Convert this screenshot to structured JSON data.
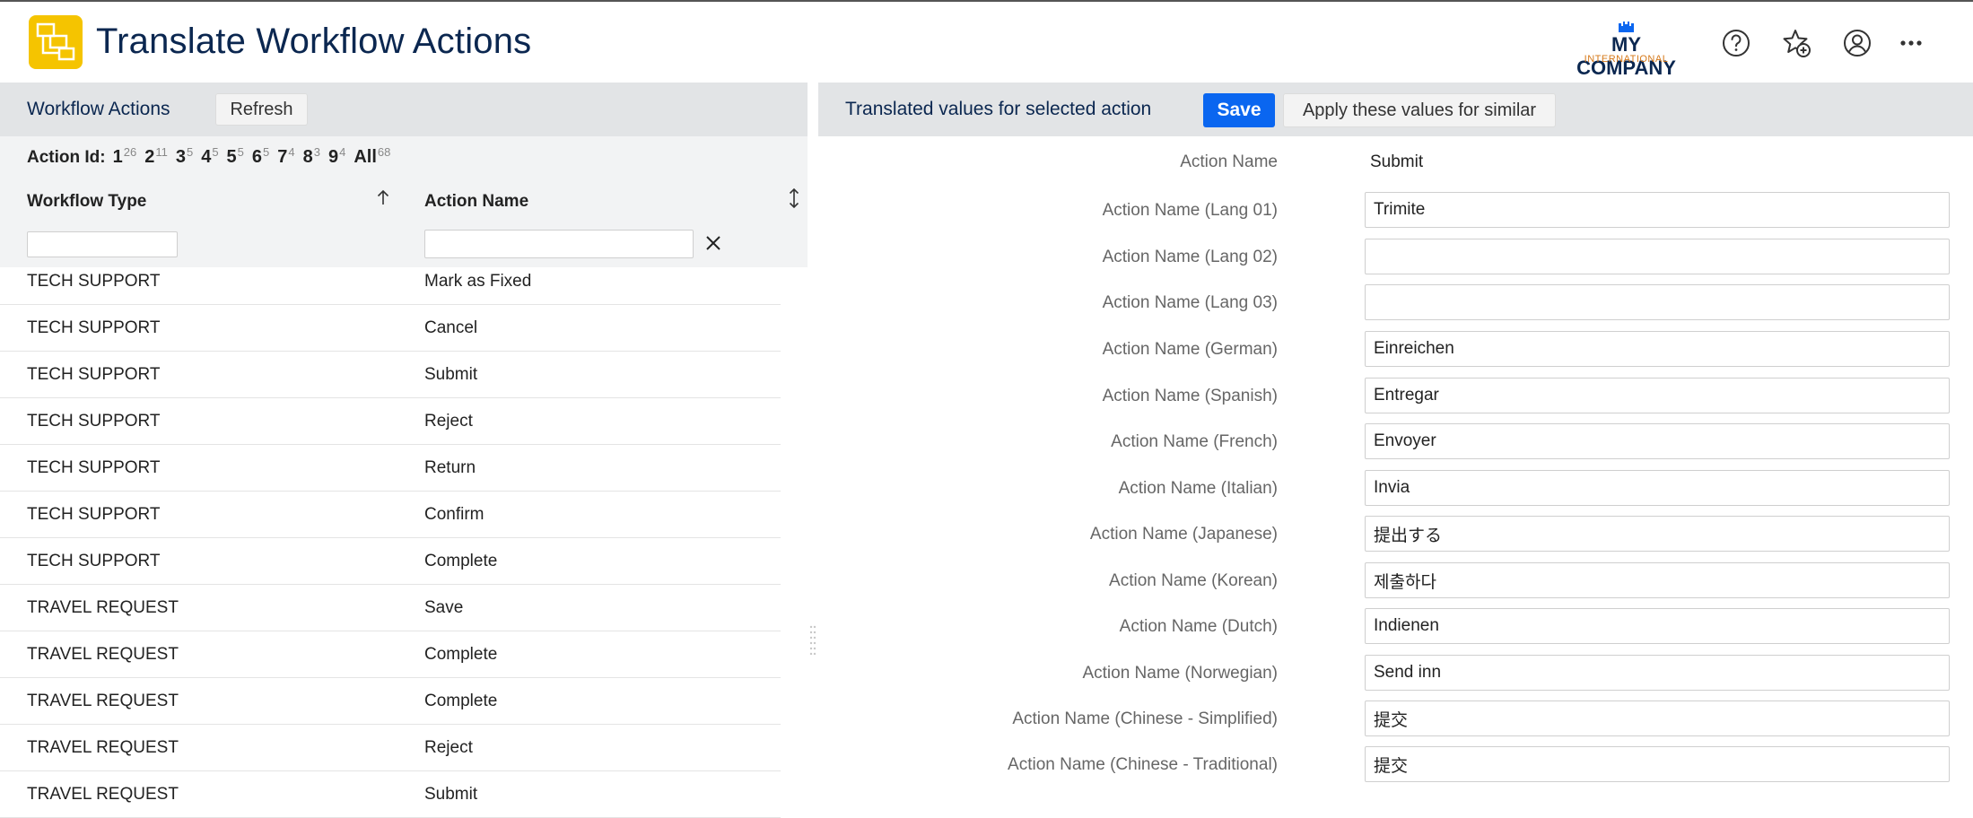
{
  "header": {
    "title": "Translate Workflow Actions",
    "logo_line1": "MY COMPANY",
    "logo_line2": "INTERNATIONAL"
  },
  "left_panel": {
    "title": "Workflow Actions",
    "refresh_label": "Refresh",
    "action_id_label": "Action Id:",
    "action_id_filters": [
      {
        "label": "1",
        "count": "26"
      },
      {
        "label": "2",
        "count": "11"
      },
      {
        "label": "3",
        "count": "5"
      },
      {
        "label": "4",
        "count": "5"
      },
      {
        "label": "5",
        "count": "5"
      },
      {
        "label": "6",
        "count": "5"
      },
      {
        "label": "7",
        "count": "4"
      },
      {
        "label": "8",
        "count": "3"
      },
      {
        "label": "9",
        "count": "4"
      },
      {
        "label": "All",
        "count": "68"
      }
    ],
    "columns": {
      "workflow_type": "Workflow Type",
      "action_name": "Action Name"
    },
    "filters": {
      "workflow_type": "",
      "action_name": ""
    },
    "rows": [
      {
        "type": "TECH SUPPORT",
        "action": "Mark as Fixed"
      },
      {
        "type": "TECH SUPPORT",
        "action": "Cancel"
      },
      {
        "type": "TECH SUPPORT",
        "action": "Submit"
      },
      {
        "type": "TECH SUPPORT",
        "action": "Reject"
      },
      {
        "type": "TECH SUPPORT",
        "action": "Return"
      },
      {
        "type": "TECH SUPPORT",
        "action": "Confirm"
      },
      {
        "type": "TECH SUPPORT",
        "action": "Complete"
      },
      {
        "type": "TRAVEL REQUEST",
        "action": "Save"
      },
      {
        "type": "TRAVEL REQUEST",
        "action": "Complete"
      },
      {
        "type": "TRAVEL REQUEST",
        "action": "Complete"
      },
      {
        "type": "TRAVEL REQUEST",
        "action": "Reject"
      },
      {
        "type": "TRAVEL REQUEST",
        "action": "Submit"
      }
    ]
  },
  "right_panel": {
    "title": "Translated values for selected action",
    "save_label": "Save",
    "apply_label": "Apply these values for similar",
    "action_name_label": "Action Name",
    "action_name_value": "Submit",
    "fields": [
      {
        "label": "Action Name (Lang 01)",
        "value": "Trimite"
      },
      {
        "label": "Action Name (Lang 02)",
        "value": ""
      },
      {
        "label": "Action Name (Lang 03)",
        "value": ""
      },
      {
        "label": "Action Name (German)",
        "value": "Einreichen"
      },
      {
        "label": "Action Name (Spanish)",
        "value": "Entregar"
      },
      {
        "label": "Action Name (French)",
        "value": "Envoyer"
      },
      {
        "label": "Action Name (Italian)",
        "value": "Invia"
      },
      {
        "label": "Action Name (Japanese)",
        "value": "提出する"
      },
      {
        "label": "Action Name (Korean)",
        "value": "제출하다"
      },
      {
        "label": "Action Name (Dutch)",
        "value": "Indienen"
      },
      {
        "label": "Action Name (Norwegian)",
        "value": "Send inn"
      },
      {
        "label": "Action Name (Chinese - Simplified)",
        "value": "提交"
      },
      {
        "label": "Action Name (Chinese - Traditional)",
        "value": "提交"
      }
    ]
  },
  "colors": {
    "brand_navy": "#0b2750",
    "save_blue": "#0a66f0",
    "app_icon_yellow": "#f5c400",
    "logo_orange": "#d6791a"
  },
  "icons": [
    "app-workflow-icon",
    "help-icon",
    "favorite-add-icon",
    "account-icon",
    "more-icon",
    "sort-ascending-icon",
    "sort-toggle-icon",
    "clear-filter-icon",
    "splitter-grip-icon"
  ]
}
